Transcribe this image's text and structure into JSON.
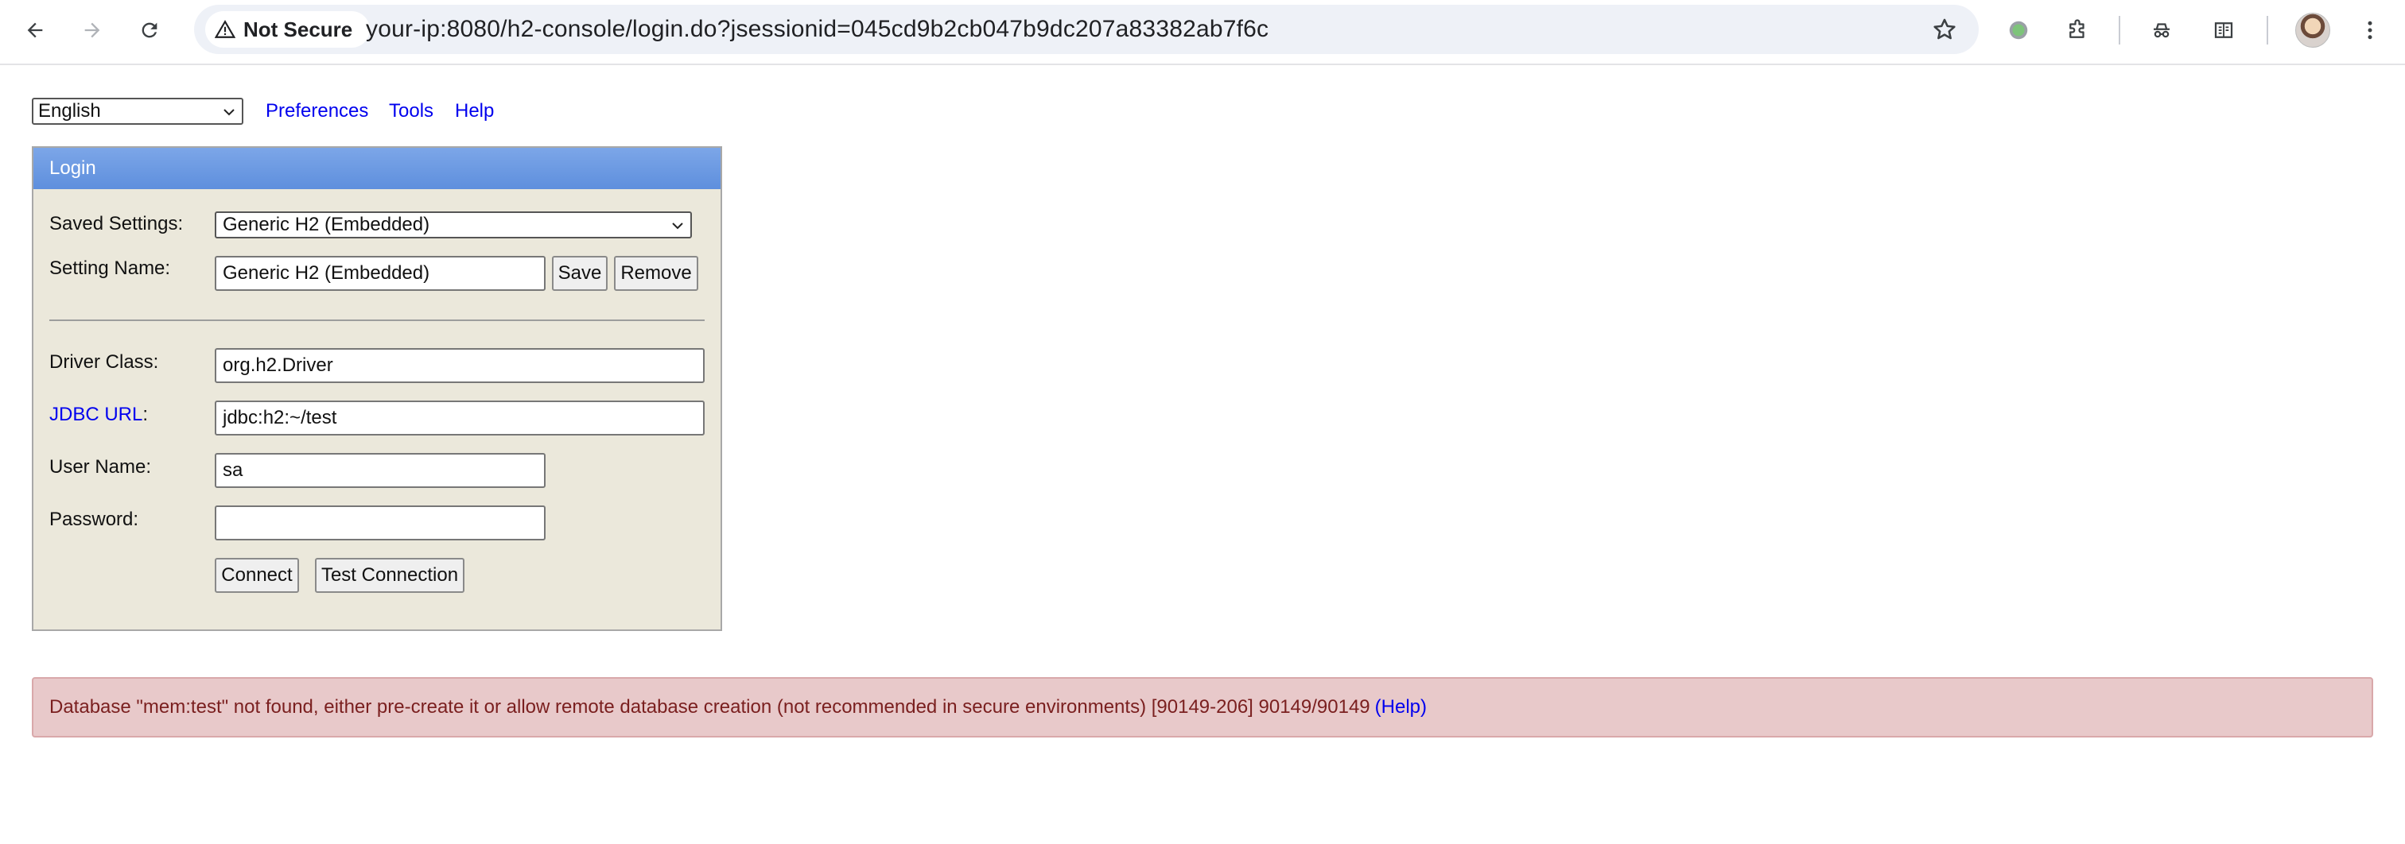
{
  "browser": {
    "security_label": "Not Secure",
    "url": "your-ip:8080/h2-console/login.do?jsessionid=045cd9b2cb047b9dc207a83382ab7f6c",
    "icons": [
      "back-arrow-icon",
      "forward-arrow-icon",
      "reload-icon",
      "warning-triangle-icon",
      "star-icon",
      "extension-status-icon",
      "puzzle-icon",
      "incognito-icon",
      "reading-list-icon",
      "avatar",
      "more-vert-icon"
    ]
  },
  "topbar": {
    "language": "English",
    "links": [
      "Preferences",
      "Tools",
      "Help"
    ]
  },
  "login": {
    "header": "Login",
    "saved_settings_label": "Saved Settings:",
    "saved_settings_value": "Generic H2 (Embedded)",
    "setting_name_label": "Setting Name:",
    "setting_name_value": "Generic H2 (Embedded)",
    "save_label": "Save",
    "remove_label": "Remove",
    "driver_class_label": "Driver Class:",
    "driver_class_value": "org.h2.Driver",
    "jdbc_url_link": "JDBC URL",
    "jdbc_url_colon": ":",
    "jdbc_url_value": "jdbc:h2:~/test",
    "user_name_label": "User Name:",
    "user_name_value": "sa",
    "password_label": "Password:",
    "password_value": "",
    "connect_label": "Connect",
    "test_connection_label": "Test Connection"
  },
  "error": {
    "message": "Database \"mem:test\" not found, either pre-create it or allow remote database creation (not recommended in secure environments) [90149-206] 90149/90149",
    "help_link": "(Help)"
  },
  "colors": {
    "panel_bg": "#ebe8db",
    "header_blue": "#6b9ae2",
    "error_bg": "#e8c9ca",
    "link": "#0000ee"
  }
}
